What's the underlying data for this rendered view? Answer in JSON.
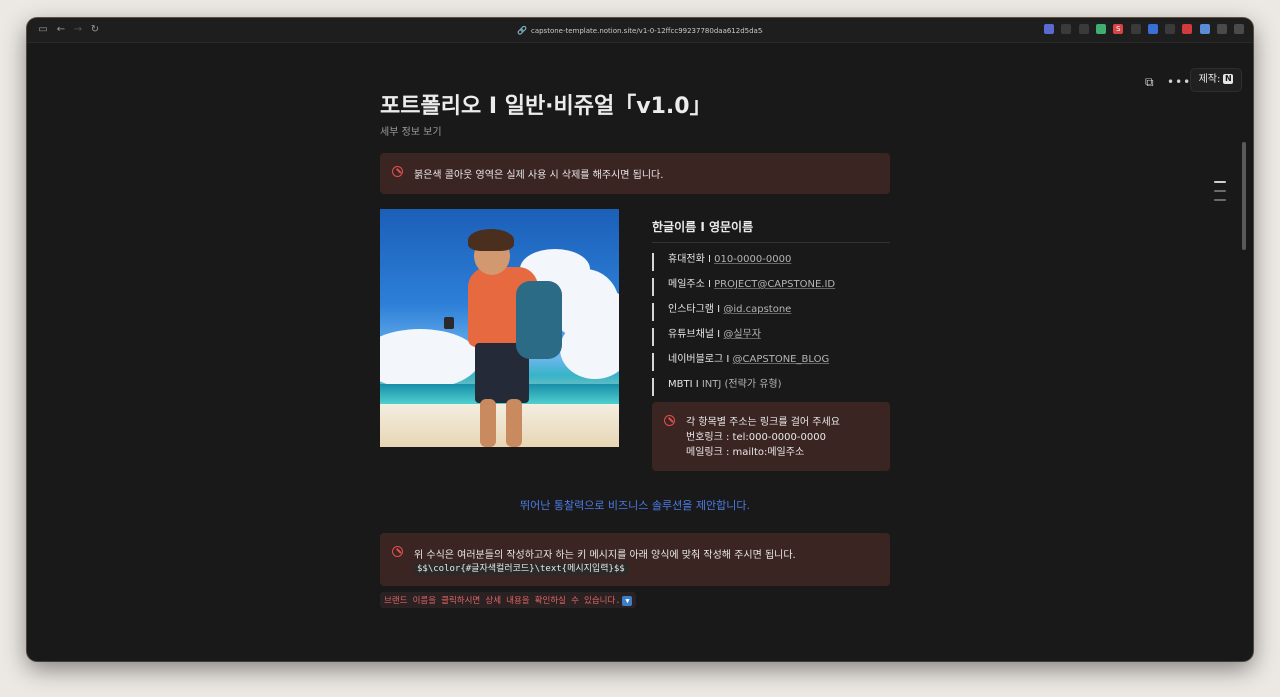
{
  "browser": {
    "url": "capstone-template.notion.site/v1-0-12ffcc99237780daa612d5da5a9bd068",
    "icons": [
      "sidebar-icon",
      "back-icon",
      "forward-icon",
      "reload-icon",
      "lock-icon"
    ],
    "extensions": [
      {
        "name": "extension-1",
        "color": "#5b6ad0"
      },
      {
        "name": "extension-2",
        "color": "#3a3a3a"
      },
      {
        "name": "extension-3",
        "color": "#3a3a3a"
      },
      {
        "name": "extension-4",
        "color": "#3fae6f"
      },
      {
        "name": "extension-5",
        "color": "#d64545",
        "label": "S"
      },
      {
        "name": "extension-6",
        "color": "#3a3a3a"
      },
      {
        "name": "extension-7",
        "color": "#3a6fd6"
      },
      {
        "name": "extension-8",
        "color": "#3a3a3a"
      },
      {
        "name": "extension-9",
        "color": "#d23b3b"
      },
      {
        "name": "extension-10",
        "color": "#5b8dd6"
      },
      {
        "name": "extension-11",
        "color": "#4a4a4a"
      },
      {
        "name": "extension-12",
        "color": "#4a4a4a"
      }
    ]
  },
  "toolbar": {
    "made_by_label": "제작:",
    "made_by_logo": "N",
    "icons": [
      "duplicate-icon",
      "more-icon"
    ]
  },
  "page": {
    "title": "포트폴리오 I 일반·비쥬얼「v1.0」",
    "details_link": "세부 정보 보기",
    "callout_top": "붉은색 콜아웃 영역은 실제 사용 시 삭제를 해주시면 됩니다.",
    "name": "한글이름 I 영문이름",
    "info": [
      {
        "label": "휴대전화 I ",
        "value": "010-0000-0000",
        "link": true
      },
      {
        "label": "메일주소 I ",
        "value": "PROJECT@CAPSTONE.ID",
        "link": true
      },
      {
        "label": "인스타그램 I ",
        "value": "@id.capstone",
        "link": true
      },
      {
        "label": "유튜브채널 I ",
        "value": "@실무자",
        "link": true
      },
      {
        "label": "네이버블로그 I ",
        "value": "@CAPSTONE_BLOG",
        "link": true
      },
      {
        "label": "MBTI I ",
        "value": "INTJ (전략가 유형)",
        "link": false
      }
    ],
    "callout_links": {
      "line1": "각 항목별 주소는 링크를 걸어 주세요",
      "line2": "번호링크 : tel:000-0000-0000",
      "line3": "메일링크 : mailto:메일주소"
    },
    "tagline": "뛰어난 통찰력으로 비즈니스 솔루션을 제안합니다.",
    "tagline_color": "#4b7ce6",
    "callout_bottom": {
      "text": "위 수식은 여러분들의 작성하고자 하는 키 메시지를 아래 양식에 맞춰 작성해 주시면 됩니다.",
      "code": "$$\\color{#글자색컬러코드}\\text{메시지입력}$$"
    },
    "brand_note": "브랜드 이름을 클릭하시면 상세 내용을 확인하실 수 있습니다.",
    "callout_color": "#3a2522",
    "accent_red": "#e2504d"
  }
}
